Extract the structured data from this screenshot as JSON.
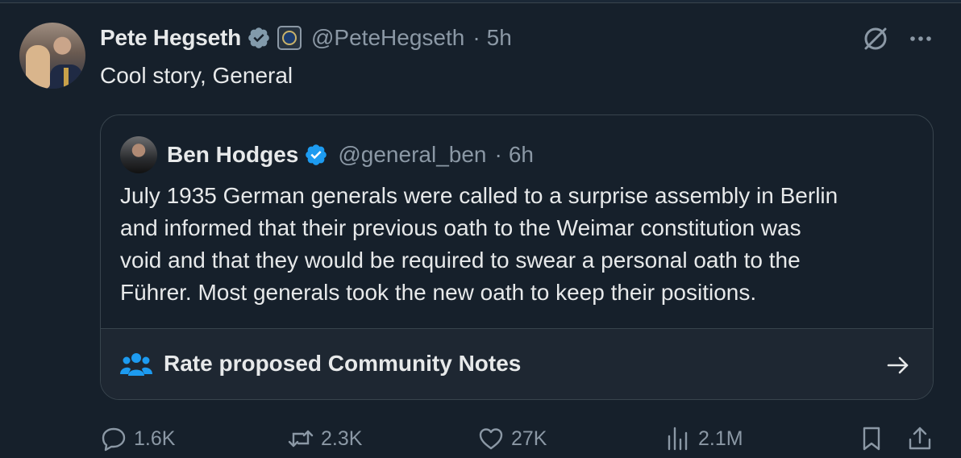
{
  "tweet": {
    "author_name": "Pete Hegseth",
    "handle": "@PeteHegseth",
    "separator": "·",
    "time": "5h",
    "text": "Cool story, General"
  },
  "quote": {
    "author_name": "Ben Hodges",
    "handle": "@general_ben",
    "separator": "·",
    "time": "6h",
    "lines": [
      "July 1935 German generals were called to a surprise assembly in Berlin",
      "and informed that their previous oath to the Weimar constitution was",
      "void and that they would be required to swear a personal oath to the",
      "Führer. Most generals took the new oath to keep their positions."
    ],
    "community_notes_label": "Rate proposed Community Notes"
  },
  "actions": {
    "replies": "1.6K",
    "reposts": "2.3K",
    "likes": "27K",
    "views": "2.1M"
  },
  "icons": {
    "verified_main": "verified-gray-badge-icon",
    "affiliation": "dod-seal-icon",
    "verified_quote": "verified-blue-badge-icon",
    "grok": "grok-icon",
    "more": "more-icon",
    "community_notes": "community-notes-icon",
    "arrow": "arrow-right-icon",
    "reply": "reply-icon",
    "retweet": "retweet-icon",
    "like": "heart-icon",
    "views": "views-icon",
    "bookmark": "bookmark-icon",
    "share": "share-icon"
  },
  "colors": {
    "background": "#16202b",
    "text": "#e7e9ea",
    "muted": "#8b98a5",
    "verified_gray": "#829aab",
    "verified_blue": "#1d9bf0",
    "border": "#38444d"
  }
}
